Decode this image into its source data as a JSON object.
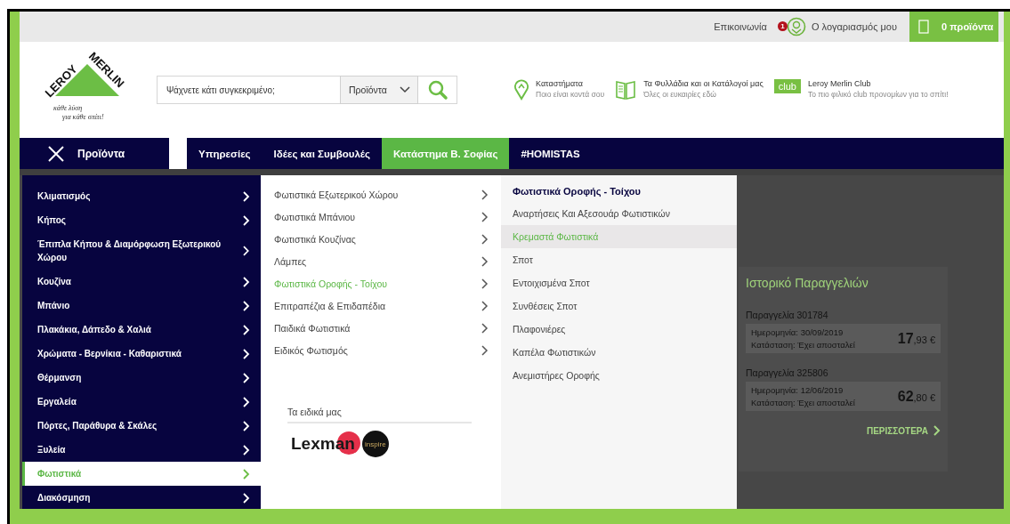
{
  "top_bar": {
    "contact": "Επικοινωνία",
    "account": {
      "label": "Ο λογαριασμός μου",
      "badge": "1"
    },
    "cart": "0 προϊόντα"
  },
  "logo": {
    "left": "LEROY",
    "right": "MERLIN",
    "tagline": [
      "κάθε λύση",
      "για κάθε σπίτι!"
    ]
  },
  "search": {
    "placeholder": "Ψάχνετε κάτι συγκεκριμένο;",
    "scope": "Προϊόντα"
  },
  "links": [
    {
      "kind": "stores",
      "title": "Καταστήματα",
      "subtitle": "Ποιο είναι κοντά σου"
    },
    {
      "kind": "catalogs",
      "title": "Τα Φυλλάδια και οι Κατάλογοί μας",
      "subtitle": "Όλες οι ευκαιρίες εδώ"
    },
    {
      "kind": "club",
      "badge": "club",
      "title": "Leroy Merlin Club",
      "subtitle": "Το πιο φιλικό club προνομίων για το σπίτι!"
    }
  ],
  "nav": {
    "menu": {
      "label": "Προϊόντα",
      "expanded": true
    },
    "tabs": [
      {
        "label": "Υπηρεσίες",
        "selected": false
      },
      {
        "label": "Ιδέες και Συμβουλές",
        "selected": false
      },
      {
        "label": "Κατάστημα Β. Σοφίας",
        "selected": true
      },
      {
        "label": "#HOMISTAS",
        "selected": false
      }
    ]
  },
  "categories": [
    {
      "label": "Κλιματισμός",
      "selected": false
    },
    {
      "label": "Κήπος",
      "selected": false
    },
    {
      "label": "Έπιπλα Κήπου & Διαμόρφωση Εξωτερικού Χώρου",
      "selected": false
    },
    {
      "label": "Κουζίνα",
      "selected": false
    },
    {
      "label": "Μπάνιο",
      "selected": false
    },
    {
      "label": "Πλακάκια, Δάπεδο & Χαλιά",
      "selected": false
    },
    {
      "label": "Χρώματα - Βερνίκια - Καθαριστικά",
      "selected": false
    },
    {
      "label": "Θέρμανση",
      "selected": false
    },
    {
      "label": "Εργαλεία",
      "selected": false
    },
    {
      "label": "Πόρτες, Παράθυρα & Σκάλες",
      "selected": false
    },
    {
      "label": "Ξυλεία",
      "selected": false
    },
    {
      "label": "Φωτιστικά",
      "selected": true
    },
    {
      "label": "Διακόσμηση",
      "selected": false
    }
  ],
  "subcategories": [
    {
      "label": "Φωτιστικά Εξωτερικού Χώρου",
      "selected": false
    },
    {
      "label": "Φωτιστικά Μπάνιου",
      "selected": false
    },
    {
      "label": "Φωτιστικά Κουζίνας",
      "selected": false
    },
    {
      "label": "Λάμπες",
      "selected": false
    },
    {
      "label": "Φωτιστικά Οροφής - Τοίχου",
      "selected": true
    },
    {
      "label": "Επιτραπέζια & Επιδαπέδια",
      "selected": false
    },
    {
      "label": "Παιδικά Φωτιστικά",
      "selected": false
    },
    {
      "label": "Ειδικός Φωτισμός",
      "selected": false
    }
  ],
  "brands": {
    "title": "Τα ειδικά μας",
    "items": [
      {
        "kind": "lexman",
        "label": "Lexman"
      },
      {
        "kind": "inspire",
        "label": "inspire"
      }
    ]
  },
  "detail": {
    "title": "Φωτιστικά Οροφής - Τοίχου",
    "items": [
      {
        "label": "Αναρτήσεις Και Αξεσουάρ Φωτιστικών",
        "selected": false
      },
      {
        "label": "Κρεμαστά Φωτιστικά",
        "selected": true
      },
      {
        "label": "Σποτ",
        "selected": false
      },
      {
        "label": "Εντοιχισμένα Σποτ",
        "selected": false
      },
      {
        "label": "Συνθέσεις Σποτ",
        "selected": false
      },
      {
        "label": "Πλαφονιέρες",
        "selected": false
      },
      {
        "label": "Καπέλα Φωτιστικών",
        "selected": false
      },
      {
        "label": "Ανεμιστήρες Οροφής",
        "selected": false
      }
    ]
  },
  "order_history": {
    "title": "Ιστορικό Παραγγελιών",
    "orders": [
      {
        "title": "Παραγγελία 301784",
        "date": "Ημερομηνία: 30/09/2019",
        "status": "Κατάσταση: Έχει αποσταλεί",
        "price_int": "17",
        "price_dec": ",93 €"
      },
      {
        "title": "Παραγγελία 325806",
        "date": "Ημερομηνία: 12/06/2019",
        "status": "Κατάσταση: Έχει αποσταλεί",
        "price_int": "62",
        "price_dec": ",80 €"
      }
    ],
    "more": "ΠΕΡΙΣΣΟΤΕΡΑ"
  }
}
